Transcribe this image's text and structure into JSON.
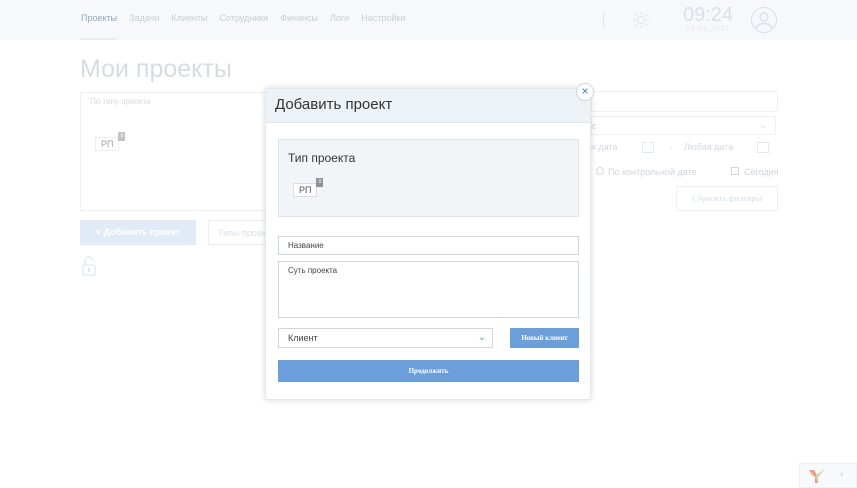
{
  "nav": {
    "items": [
      {
        "label": "Проекты",
        "active": true
      },
      {
        "label": "Задачи",
        "active": false
      },
      {
        "label": "Клиенты",
        "active": false
      },
      {
        "label": "Сотрудники",
        "active": false
      },
      {
        "label": "Финансы",
        "active": false
      },
      {
        "label": "Логи",
        "active": false
      },
      {
        "label": "Настройки",
        "active": false
      }
    ],
    "time": "09:24",
    "date": "23.06.2021",
    "icons": {
      "theme": "sun-icon",
      "user": "user-circle-icon"
    }
  },
  "page": {
    "title": "Мои проекты",
    "filter_type_label": "По типу проекта",
    "project_tag": "РП",
    "project_tag_count": "0",
    "add_project_label": "+ Добавить проект",
    "project_types_label": "Типы проек",
    "status_fragment": "с",
    "date_from_fragment": "я дата",
    "date_dash": "-",
    "date_to": "Любая дата",
    "radio_control_date": "По контрольной дате",
    "checkbox_today": "Сегодня",
    "reset_filters": "Сбросить фильтры"
  },
  "modal": {
    "title": "Добавить проект",
    "close_symbol": "×",
    "type_title": "Тип проекта",
    "type_tag": "РП",
    "type_tag_count": "0",
    "name_placeholder": "Название",
    "essence_placeholder": "Суть проекта",
    "client_selected": "Клиент",
    "new_client_label": "Новый клиент",
    "continue_label": "Продолжить"
  },
  "colors": {
    "accent": "#6b9fdc",
    "nav_active": "#2f5e8f",
    "header_bg": "#eef3f8"
  }
}
